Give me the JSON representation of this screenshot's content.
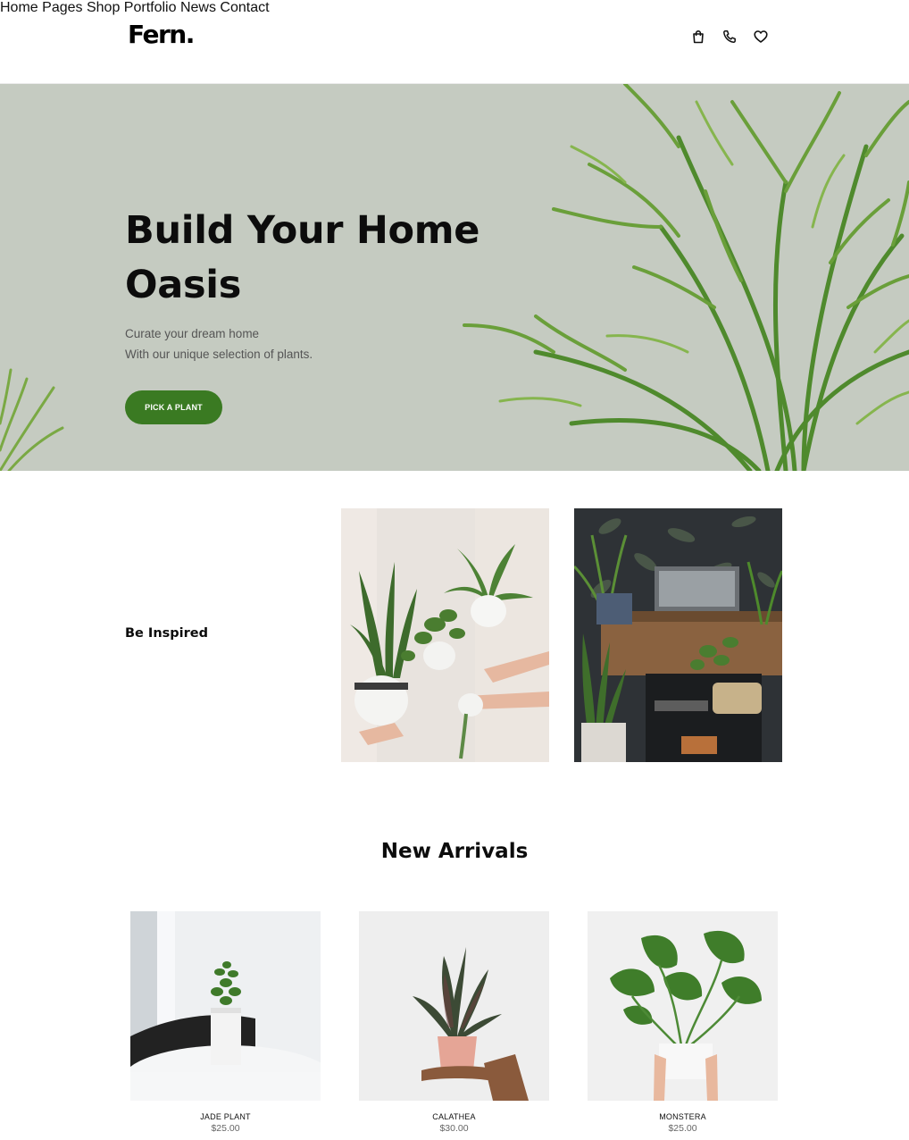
{
  "brand": {
    "logo": "Fern."
  },
  "nav": {
    "items": [
      "Home",
      "Pages",
      "Shop",
      "Portfolio",
      "News",
      "Contact"
    ]
  },
  "header_icons": [
    "bag-icon",
    "phone-icon",
    "heart-icon"
  ],
  "hero": {
    "title_line1": "Build Your Home",
    "title_line2": "Oasis",
    "subtitle_line1": "Curate your dream home",
    "subtitle_line2": "With our unique selection of plants.",
    "cta": "PICK A PLANT",
    "bg_color": "#c5cbc1",
    "cta_color": "#3a7a22"
  },
  "inspired": {
    "label": "Be Inspired"
  },
  "arrivals": {
    "title": "New Arrivals",
    "products": [
      {
        "name": "JADE PLANT",
        "price": "$25.00"
      },
      {
        "name": "CALATHEA",
        "price": "$30.00"
      },
      {
        "name": "MONSTERA",
        "price": "$25.00"
      }
    ]
  }
}
